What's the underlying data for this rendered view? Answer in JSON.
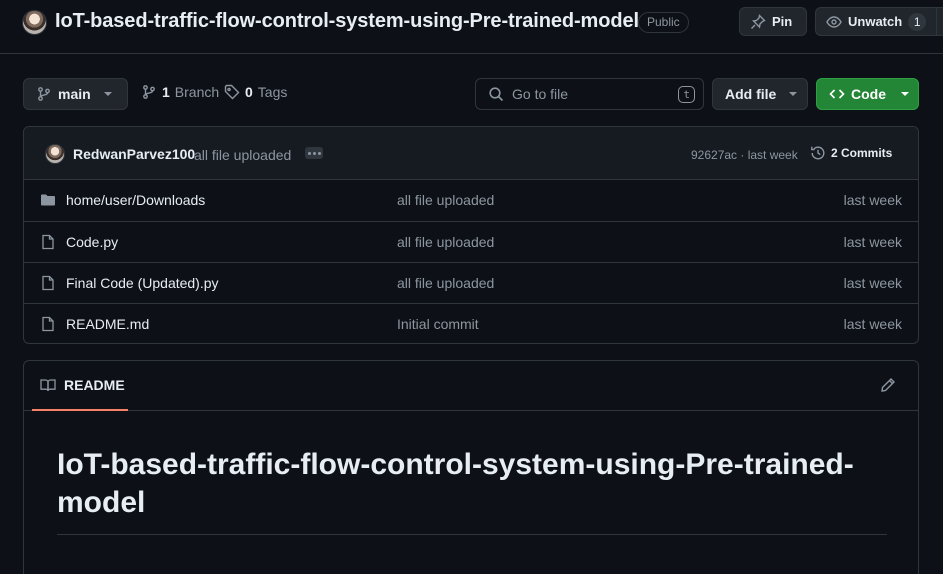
{
  "repo": {
    "title": "IoT-based-traffic-flow-control-system-using-Pre-trained-model",
    "visibility": "Public",
    "pin_label": "Pin",
    "watch_label": "Unwatch",
    "watch_count": "1"
  },
  "toolbar": {
    "branch": "main",
    "branches_count": "1",
    "branches_label": "Branch",
    "tags_count": "0",
    "tags_label": "Tags",
    "search_placeholder": "Go to file",
    "search_shortcut": "t",
    "add_file_label": "Add file",
    "code_label": "Code"
  },
  "latest_commit": {
    "author": "RedwanParvez100",
    "message": "all file uploaded",
    "hash_time": "92627ac · last week",
    "commits_label": "2 Commits"
  },
  "files": [
    {
      "type": "folder",
      "name": "home/user/Downloads",
      "message": "all file uploaded",
      "time": "last week"
    },
    {
      "type": "file",
      "name": "Code.py",
      "message": "all file uploaded",
      "time": "last week"
    },
    {
      "type": "file",
      "name": "Final Code (Updated).py",
      "message": "all file uploaded",
      "time": "last week"
    },
    {
      "type": "file",
      "name": "README.md",
      "message": "Initial commit",
      "time": "last week"
    }
  ],
  "readme": {
    "tab_label": "README",
    "heading": "IoT-based-traffic-flow-control-system-using-Pre-trained-model"
  },
  "icons": [
    "pin-icon",
    "eye-icon",
    "branch-icon",
    "tag-icon",
    "search-icon",
    "code-icon",
    "history-icon",
    "folder-icon",
    "file-icon",
    "book-icon",
    "pencil-icon",
    "caret-down-icon"
  ],
  "colors": {
    "background": "#0d1117",
    "border": "#30363d",
    "code_button": "#238636",
    "readme_tab_underline": "#f78166",
    "muted_text": "#8d96a0"
  }
}
